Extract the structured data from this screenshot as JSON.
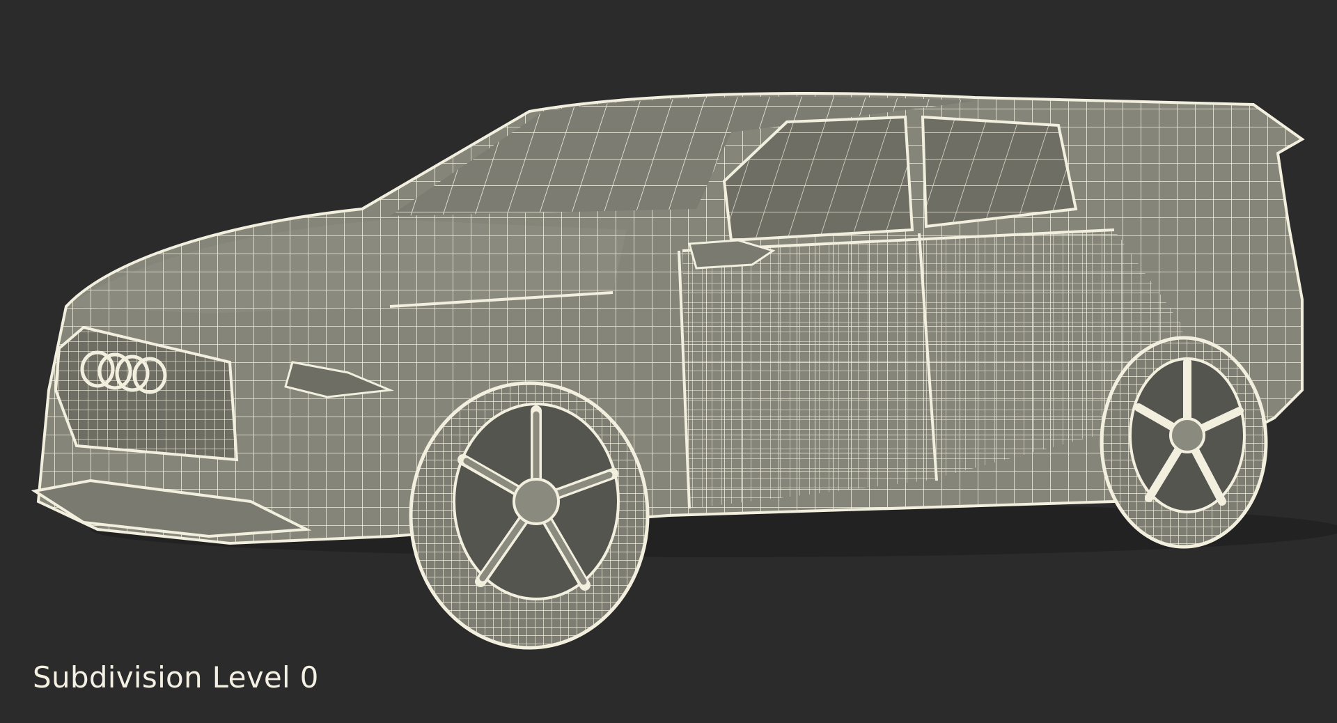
{
  "caption": "Subdivision Level 0",
  "colors": {
    "background": "#2b2b2b",
    "surface": "#85857a",
    "surface_shade": "#6e6e64",
    "wire": "#f2efdf",
    "caption_text": "#f4f1e4"
  },
  "model": {
    "subject": "car-wireframe",
    "display_mode": "wireframe-on-shaded"
  }
}
